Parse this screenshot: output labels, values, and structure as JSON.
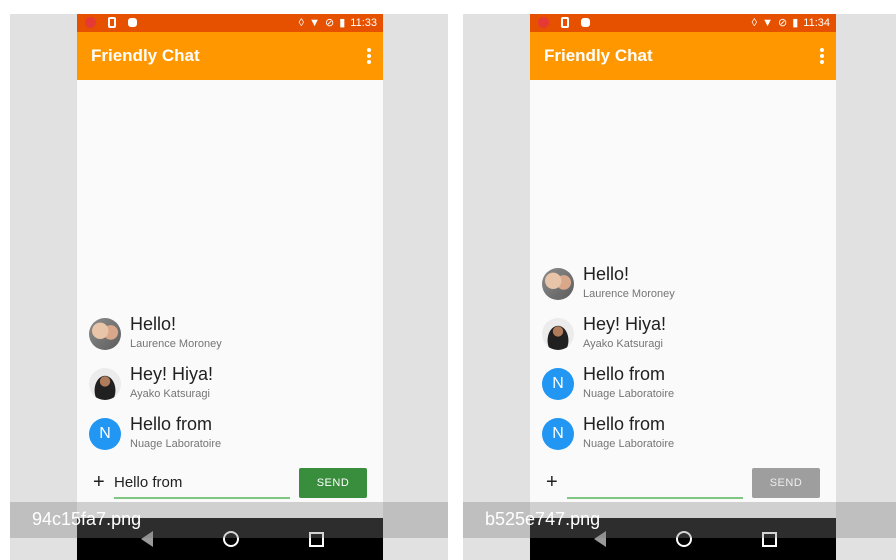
{
  "screens": [
    {
      "time": "11:33",
      "app_title": "Friendly Chat",
      "messages": [
        {
          "text": "Hello!",
          "name": "Laurence Moroney",
          "avatar": "photo"
        },
        {
          "text": "Hey! Hiya!",
          "name": "Ayako Katsuragi",
          "avatar": "photo"
        },
        {
          "text": "Hello from",
          "name": "Nuage Laboratoire",
          "avatar": "N"
        }
      ],
      "input_value": "Hello from",
      "send_label": "SEND",
      "send_enabled": true,
      "caption": "94c15fa7.png"
    },
    {
      "time": "11:34",
      "app_title": "Friendly Chat",
      "messages": [
        {
          "text": "Hello!",
          "name": "Laurence Moroney",
          "avatar": "photo"
        },
        {
          "text": "Hey! Hiya!",
          "name": "Ayako Katsuragi",
          "avatar": "photo"
        },
        {
          "text": "Hello from",
          "name": "Nuage Laboratoire",
          "avatar": "N"
        },
        {
          "text": "Hello from",
          "name": "Nuage Laboratoire",
          "avatar": "N"
        }
      ],
      "input_value": "",
      "send_label": "SEND",
      "send_enabled": false,
      "caption": "b525e747.png"
    }
  ],
  "icons": {
    "plus": "+",
    "overflow": "more-vert-icon",
    "status": [
      "record-dot-icon",
      "sim-icon",
      "notification-icon",
      "vibrate-icon",
      "wifi-icon",
      "no-sim-icon",
      "battery-icon"
    ],
    "nav": [
      "back-icon",
      "home-icon",
      "recents-icon"
    ]
  },
  "colors": {
    "status_bar": "#e65100",
    "app_bar": "#ff9800",
    "send_active": "#388e3c",
    "send_disabled": "#9e9e9e",
    "avatar_letter_bg": "#2196f3"
  }
}
